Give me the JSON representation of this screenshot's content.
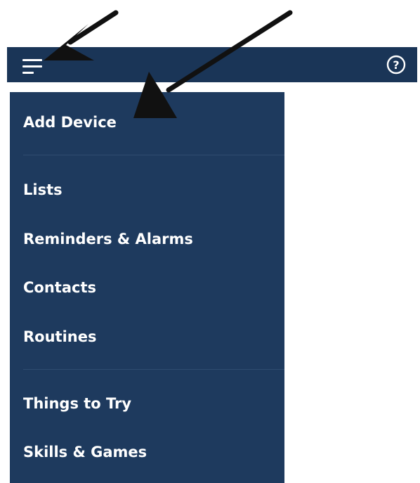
{
  "colors": {
    "topbar_background": "#1a3557",
    "menu_background": "#1e3a5e",
    "menu_text": "#ffffff",
    "divider": "#2f4c70",
    "annotation_arrow": "#111111"
  },
  "topbar": {
    "menu_icon": "hamburger-menu-icon",
    "help_icon": "help-circle-icon",
    "help_glyph": "?"
  },
  "menu": {
    "sections": [
      {
        "items": [
          {
            "label": "Add Device"
          }
        ]
      },
      {
        "items": [
          {
            "label": "Lists"
          },
          {
            "label": "Reminders & Alarms"
          },
          {
            "label": "Contacts"
          },
          {
            "label": "Routines"
          }
        ]
      },
      {
        "items": [
          {
            "label": "Things to Try"
          },
          {
            "label": "Skills & Games"
          }
        ]
      }
    ]
  },
  "annotations": {
    "arrow_icons": [
      "arrow-pointing-to-menu-icon",
      "arrow-pointing-to-add-device-icon"
    ]
  }
}
